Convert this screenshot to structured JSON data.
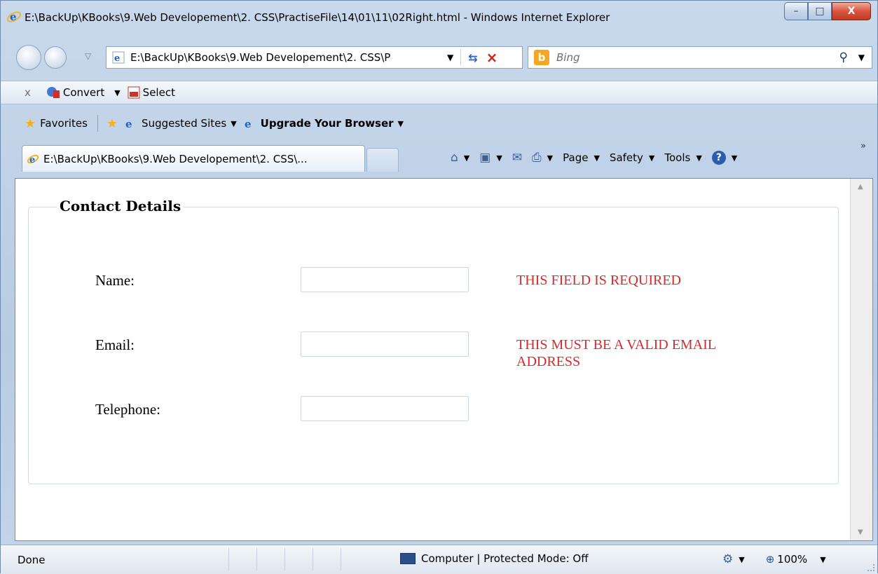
{
  "window": {
    "title": "E:\\BackUp\\KBooks\\9.Web Developement\\2. CSS\\PractiseFile\\14\\01\\11\\02Right.html - Windows Internet Explorer",
    "minimize_glyph": "–",
    "maximize_glyph": "□",
    "close_glyph": "X"
  },
  "nav": {
    "address": "E:\\BackUp\\KBooks\\9.Web Developement\\2. CSS\\P",
    "search_placeholder": "Bing",
    "bing_letter": "b"
  },
  "convert_toolbar": {
    "close_glyph": "x",
    "convert_label": "Convert",
    "select_label": "Select"
  },
  "favorites_bar": {
    "favorites_label": "Favorites",
    "suggested_sites_label": "Suggested Sites",
    "upgrade_label": "Upgrade Your Browser"
  },
  "tabs": {
    "active_tab_label": "E:\\BackUp\\KBooks\\9.Web Developement\\2. CSS\\..."
  },
  "command_bar": {
    "page_label": "Page",
    "safety_label": "Safety",
    "tools_label": "Tools",
    "more_glyph": "»"
  },
  "page": {
    "legend": "Contact Details",
    "fields": [
      {
        "label": "Name:",
        "value": "",
        "error": "THIS FIELD IS REQUIRED"
      },
      {
        "label": "Email:",
        "value": "",
        "error": "THIS MUST BE A VALID EMAIL ADDRESS"
      },
      {
        "label": "Telephone:",
        "value": "",
        "error": ""
      }
    ]
  },
  "status_bar": {
    "status": "Done",
    "zone": "Computer | Protected Mode: Off",
    "zoom": "100%"
  },
  "colors": {
    "error_text": "#d6282e",
    "close_button": "#d9543f"
  }
}
